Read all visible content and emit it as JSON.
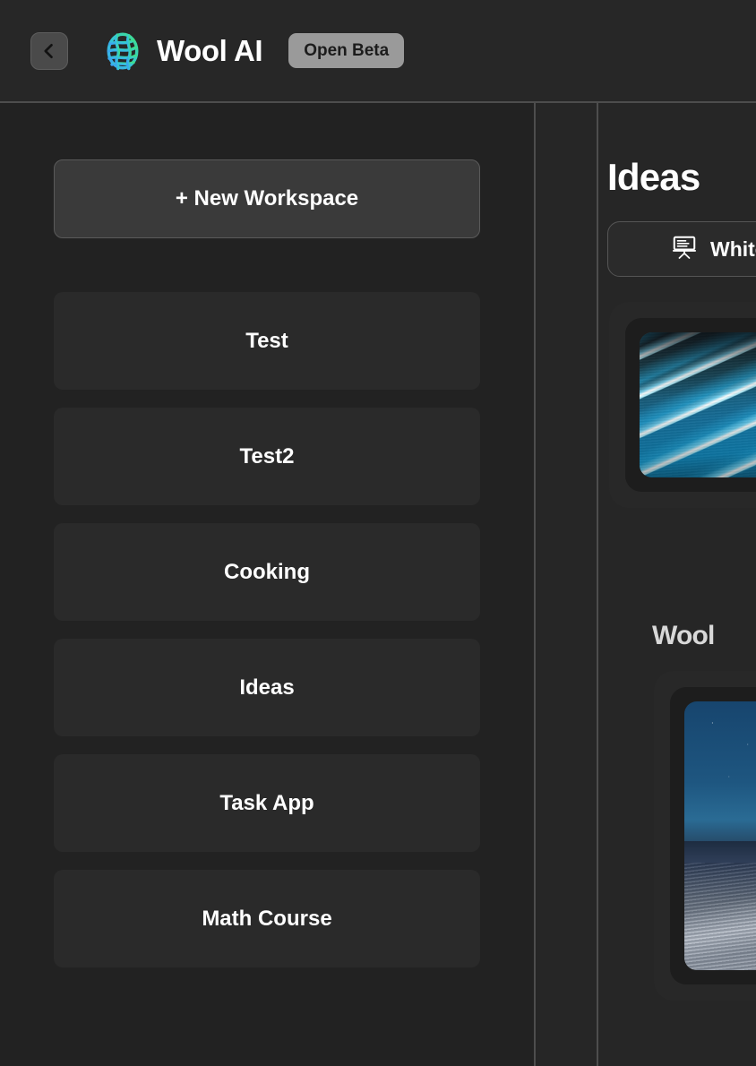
{
  "header": {
    "back_icon": "chevron-left-icon",
    "logo_icon": "wool-ball-logo-icon",
    "title": "Wool AI",
    "badge": "Open Beta",
    "logo_gradient_start": "#3aa6f0",
    "logo_gradient_end": "#3ee08a",
    "badge_bg": "#9a9a9a",
    "badge_fg": "#1c1c1c"
  },
  "sidebar": {
    "new_workspace_label": "+ New Workspace",
    "items": [
      {
        "label": "Test"
      },
      {
        "label": "Test2"
      },
      {
        "label": "Cooking"
      },
      {
        "label": "Ideas"
      },
      {
        "label": "Task App"
      },
      {
        "label": "Math Course"
      }
    ]
  },
  "panel": {
    "sections": [
      {
        "title": "Ideas",
        "whiteboard": {
          "icon": "whiteboard-easel-icon",
          "label": "Whiteboard"
        },
        "card": {
          "artwork": "neon-blue-light-streaks"
        }
      },
      {
        "title": "Wool",
        "card": {
          "artwork": "starry-night-desert-dunes"
        }
      }
    ]
  },
  "colors": {
    "app_bg": "#262626",
    "sidebar_bg": "#222222",
    "item_bg": "#2a2a2a",
    "divider": "#4d4d4d",
    "text_primary": "#ffffff",
    "text_secondary": "#d8d8d8"
  }
}
